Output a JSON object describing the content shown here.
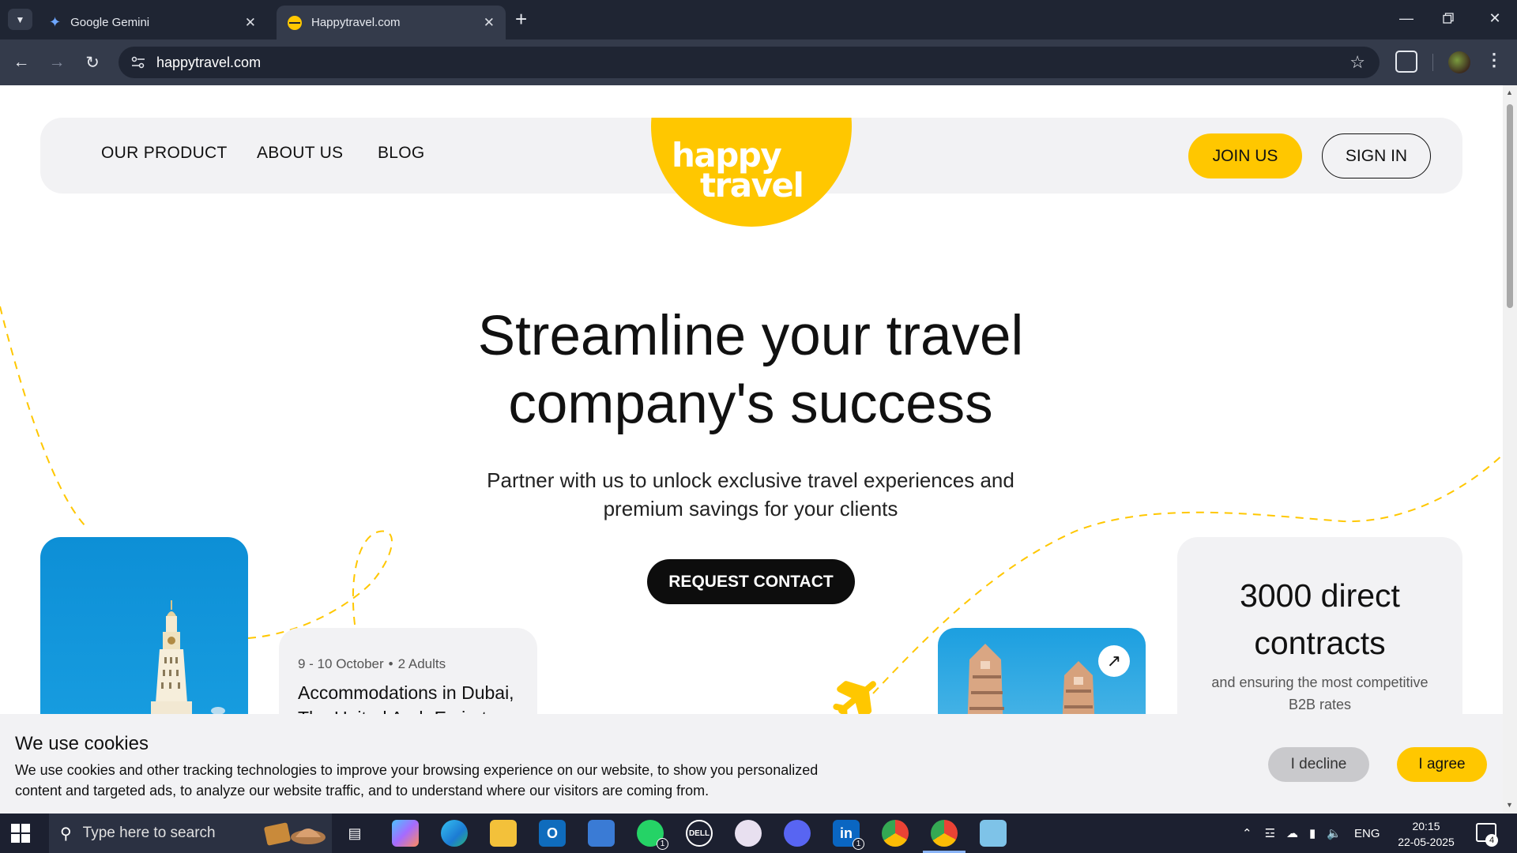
{
  "browser": {
    "tabs": [
      {
        "title": "Google Gemini",
        "favicon": "gemini-sparkle-icon",
        "active": false
      },
      {
        "title": "Happytravel.com",
        "favicon": "happytravel-sun-icon",
        "active": true
      }
    ],
    "url": "happytravel.com"
  },
  "site": {
    "nav": {
      "links": [
        "OUR PRODUCT",
        "ABOUT US",
        "BLOG"
      ],
      "logo_line1": "happy",
      "logo_line2": "travel",
      "join_label": "JOIN US",
      "signin_label": "SIGN IN"
    },
    "hero": {
      "title_line1": "Streamline your travel",
      "title_line2": "company's success",
      "subtitle_line1": "Partner with us to unlock exclusive travel experiences and",
      "subtitle_line2": "premium savings for your clients",
      "cta_label": "REQUEST CONTACT"
    },
    "booking_card": {
      "dates": "9 - 10 October",
      "guests": "2 Adults",
      "title_line1": "Accommodations in Dubai,",
      "title_line2": "The United Arab Emirates"
    },
    "stats_card": {
      "title": "3000 direct contracts",
      "subtitle": "and ensuring the most competitive B2B rates"
    },
    "cookie": {
      "title": "We use cookies",
      "text_line1": "We use cookies and other tracking technologies to improve your browsing experience on our website, to show you personalized",
      "text_line2": "content and targeted ads, to analyze our website traffic, and to understand where our visitors are coming from.",
      "decline_label": "I decline",
      "agree_label": "I agree"
    },
    "colors": {
      "brand_yellow": "#ffc700",
      "dark": "#0d0d0d",
      "panel_grey": "#f2f2f4"
    }
  },
  "taskbar": {
    "search_placeholder": "Type here to search",
    "apps": [
      "task-view-icon",
      "copilot-icon",
      "edge-icon",
      "file-explorer-icon",
      "outlook-icon",
      "remote-desktop-icon",
      "whatsapp-icon",
      "dell-icon",
      "cloud-app-icon",
      "discord-icon",
      "linkedin-icon",
      "chrome-profile-icon",
      "chrome-icon",
      "notepad-icon"
    ],
    "whatsapp_badge": "1",
    "linkedin_badge": "1",
    "language": "ENG",
    "time": "20:15",
    "date": "22-05-2025",
    "notification_count": "4"
  }
}
